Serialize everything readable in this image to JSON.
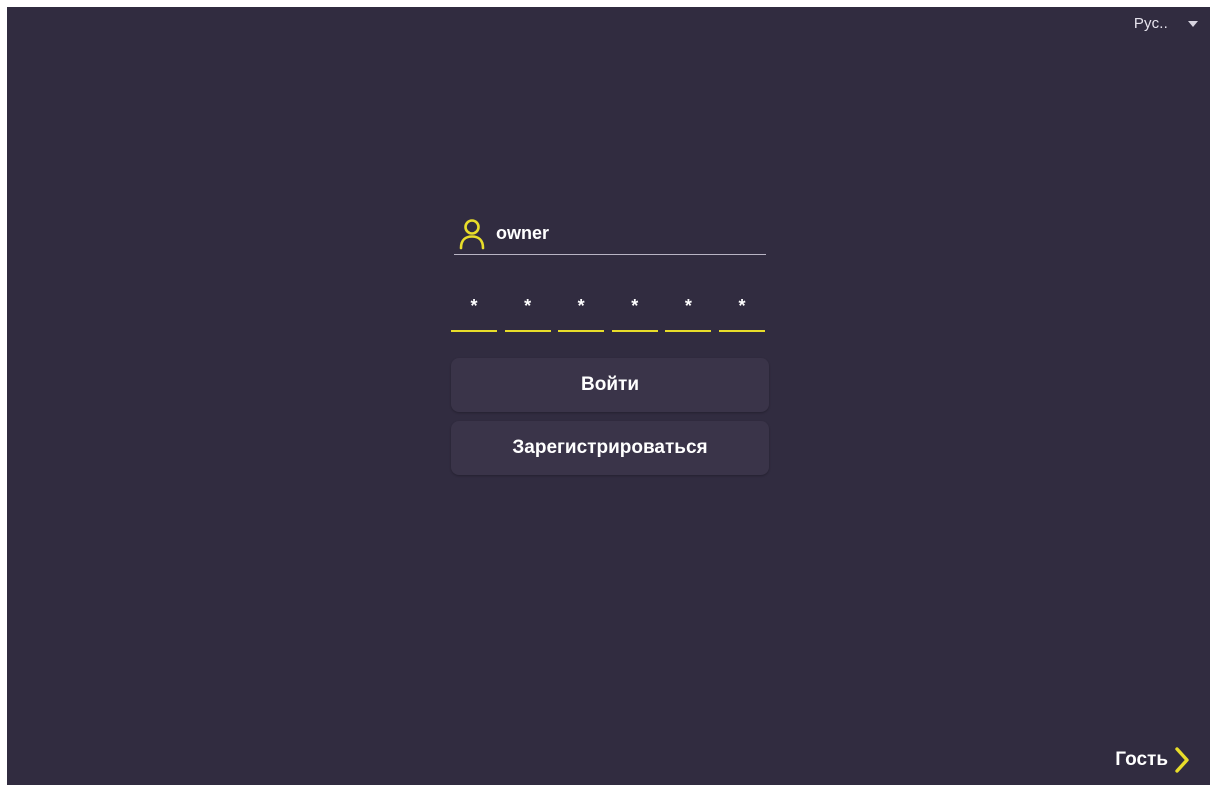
{
  "language": {
    "selected": "Рус..",
    "dropdown_icon": "caret-down-icon"
  },
  "login": {
    "user_icon": "user-icon",
    "username_value": "owner",
    "pin": [
      "*",
      "*",
      "*",
      "*",
      "*",
      "*"
    ],
    "login_button_label": "Войти",
    "register_button_label": "Зарегистрироваться"
  },
  "guest": {
    "label": "Гость",
    "arrow_icon": "chevron-right-icon"
  },
  "colors": {
    "background": "#312c40",
    "button": "#3a3449",
    "accent_yellow": "#e8dd2a",
    "text": "#ffffff"
  }
}
